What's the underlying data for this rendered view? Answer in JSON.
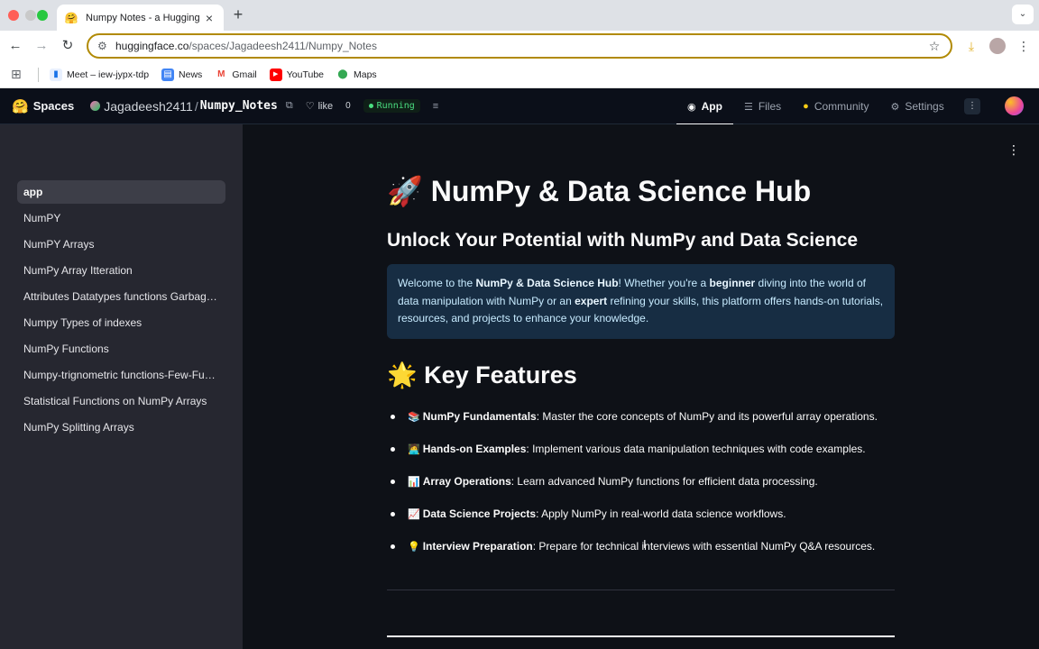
{
  "browser": {
    "tab_title": "Numpy Notes - a Hugging Face",
    "url_host": "huggingface.co",
    "url_path": "/spaces/Jagadeesh2411/Numpy_Notes",
    "bookmarks": [
      {
        "label": "Meet – iew-jypx-tdp",
        "icon": "meet-icon",
        "color": "#1a73e8"
      },
      {
        "label": "News",
        "icon": "news-icon",
        "color": "#4285f4"
      },
      {
        "label": "Gmail",
        "icon": "gmail-icon",
        "color": "#ea4335"
      },
      {
        "label": "YouTube",
        "icon": "youtube-icon",
        "color": "#ff0000"
      },
      {
        "label": "Maps",
        "icon": "maps-icon",
        "color": "#34a853"
      }
    ]
  },
  "hf": {
    "brand": "Spaces",
    "owner": "Jagadeesh2411",
    "repo": "Numpy_Notes",
    "like_label": "like",
    "like_count": "0",
    "status": "Running",
    "tabs": [
      {
        "label": "App",
        "icon": "app-icon"
      },
      {
        "label": "Files",
        "icon": "files-icon"
      },
      {
        "label": "Community",
        "icon": "community-icon"
      },
      {
        "label": "Settings",
        "icon": "gear-icon"
      }
    ]
  },
  "sidebar": {
    "items": [
      "app",
      "NumPY",
      "NumPY Arrays",
      "NumPy Array Itteration",
      "Attributes Datatypes functions Garbag…",
      "Numpy Types of indexes",
      "NumPy Functions",
      "Numpy-trignometric functions-Few-Fu…",
      "Statistical Functions on NumPy Arrays",
      "NumPy Splitting Arrays"
    ]
  },
  "main": {
    "title": "NumPy & Data Science Hub",
    "title_emoji": "🚀",
    "subtitle": "Unlock Your Potential with NumPy and Data Science",
    "info": {
      "t1": "Welcome to the ",
      "b1": "NumPy & Data Science Hub",
      "t2": "! Whether you're a ",
      "b2": "beginner",
      "t3": " diving into the world of data manipulation with NumPy or an ",
      "b3": "expert",
      "t4": " refining your skills, this platform offers hands-on tutorials, resources, and projects to enhance your knowledge."
    },
    "features_title": "Key Features",
    "features_emoji": "🌟",
    "features": [
      {
        "emoji": "📚",
        "bold": "NumPy Fundamentals",
        "text": ": Master the core concepts of NumPy and its powerful array operations."
      },
      {
        "emoji": "🧑‍💻",
        "bold": "Hands-on Examples",
        "text": ": Implement various data manipulation techniques with code examples."
      },
      {
        "emoji": "📊",
        "bold": "Array Operations",
        "text": ": Learn advanced NumPy functions for efficient data processing."
      },
      {
        "emoji": "📈",
        "bold": "Data Science Projects",
        "text": ": Apply NumPy in real-world data science workflows."
      },
      {
        "emoji": "💡",
        "bold": "Interview Preparation",
        "text": ": Prepare for technical interviews with essential NumPy Q&A resources."
      }
    ]
  }
}
